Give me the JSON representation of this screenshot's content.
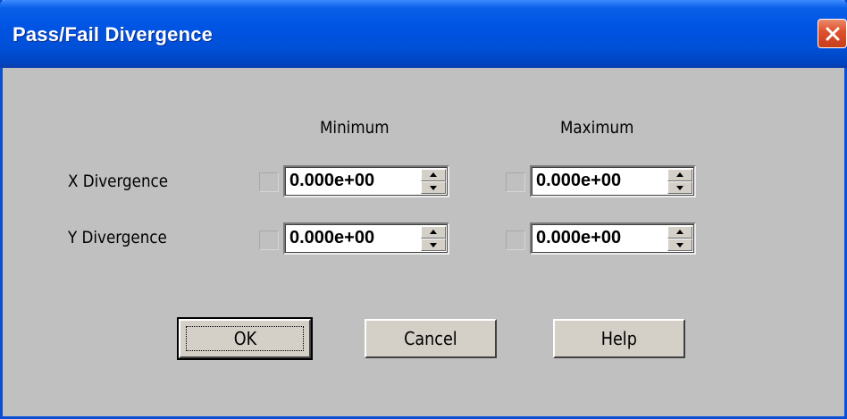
{
  "window": {
    "title": "Pass/Fail Divergence"
  },
  "columns": {
    "minimum": "Minimum",
    "maximum": "Maximum"
  },
  "rows": [
    {
      "label": "X Divergence",
      "min_checked": false,
      "min_value": "0.000e+00",
      "max_checked": false,
      "max_value": "0.000e+00"
    },
    {
      "label": "Y Divergence",
      "min_checked": false,
      "min_value": "0.000e+00",
      "max_checked": false,
      "max_value": "0.000e+00"
    }
  ],
  "buttons": {
    "ok": "OK",
    "cancel": "Cancel",
    "help": "Help"
  },
  "colors": {
    "titlebar": "#0054e3",
    "face": "#c0c0c0",
    "close": "#e0542f"
  }
}
